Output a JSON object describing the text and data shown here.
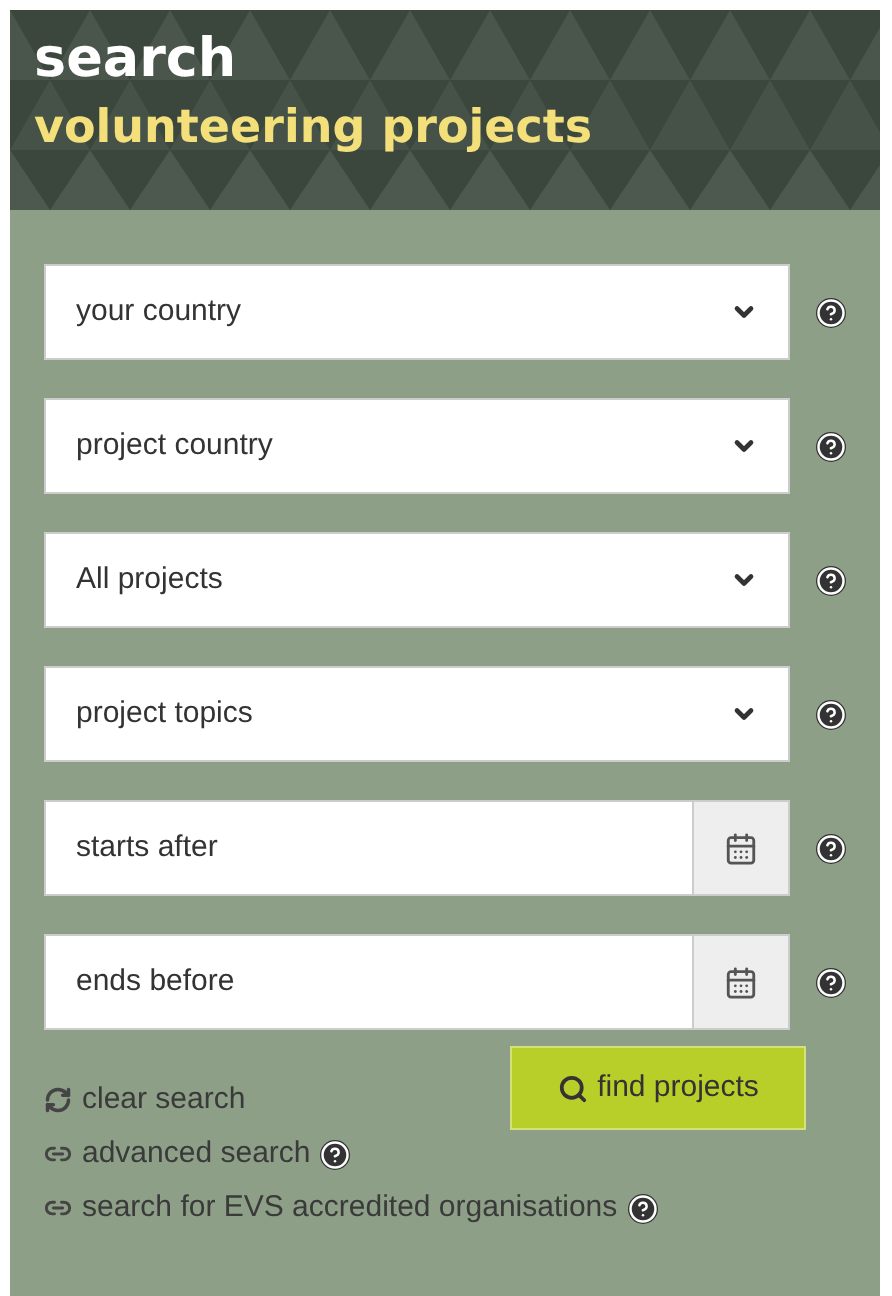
{
  "header": {
    "title": "search",
    "subtitle": "volunteering projects"
  },
  "fields": [
    {
      "kind": "select",
      "value": "your country",
      "help": true
    },
    {
      "kind": "select",
      "value": "project country",
      "help": true
    },
    {
      "kind": "select",
      "value": "All projects",
      "help": true
    },
    {
      "kind": "select",
      "value": "project topics",
      "help": true
    },
    {
      "kind": "date",
      "value": "starts after",
      "help": true
    },
    {
      "kind": "date",
      "value": "ends before",
      "help": true
    }
  ],
  "submit": {
    "label": "find projects"
  },
  "links": [
    {
      "kind": "clear",
      "label": "clear search",
      "help": false
    },
    {
      "kind": "link",
      "label": "advanced search",
      "help": true
    },
    {
      "kind": "link",
      "label": "search for EVS accredited organisations",
      "help": true
    }
  ]
}
